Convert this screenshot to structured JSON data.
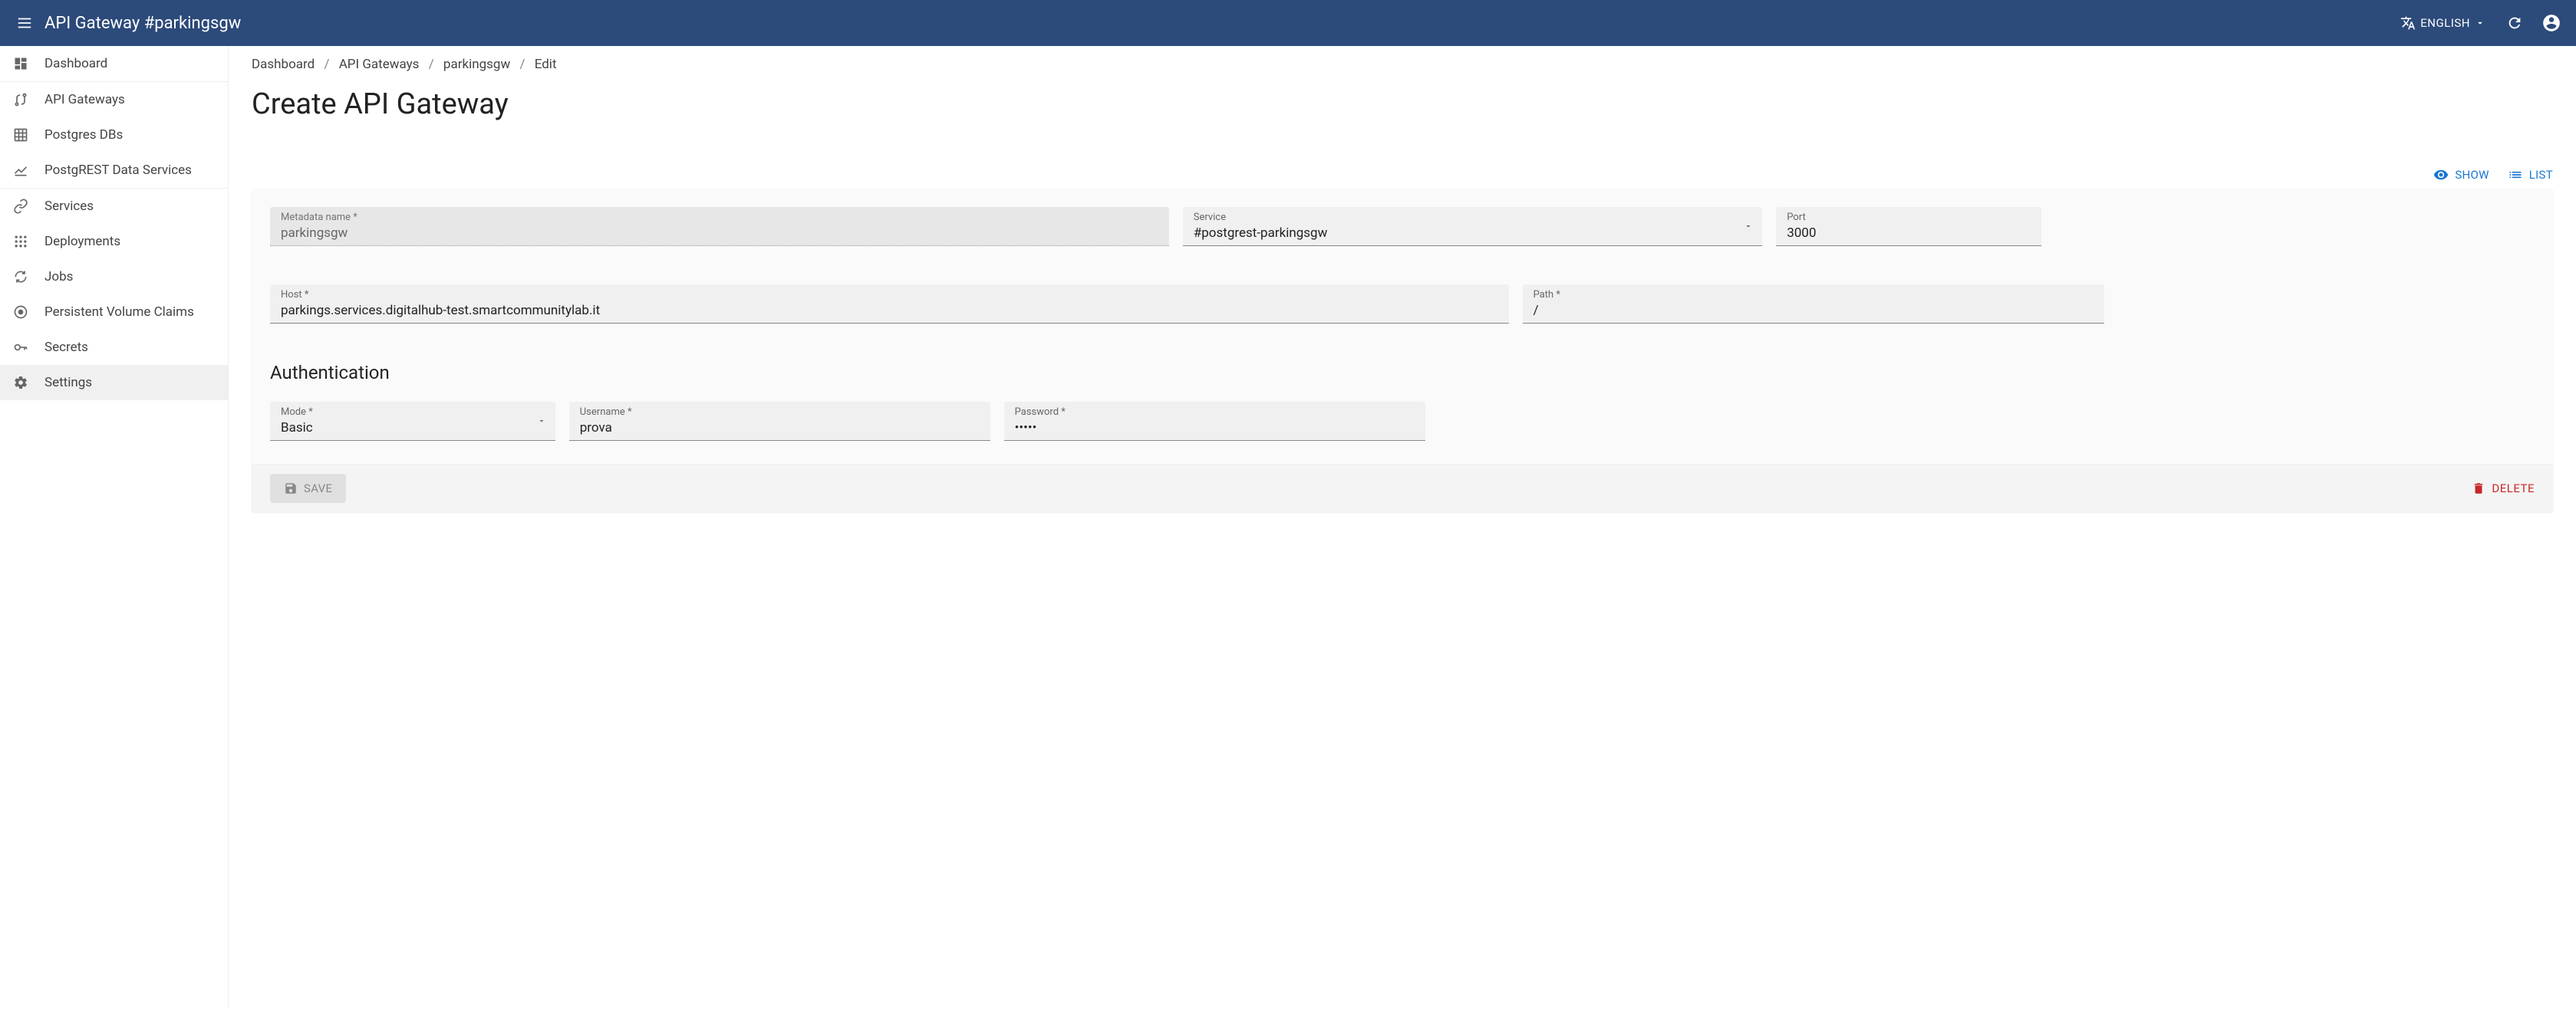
{
  "header": {
    "title": "API Gateway #parkingsgw",
    "language": "ENGLISH"
  },
  "sidebar": {
    "groups": [
      {
        "items": [
          {
            "label": "Dashboard"
          }
        ]
      },
      {
        "items": [
          {
            "label": "API Gateways"
          },
          {
            "label": "Postgres DBs"
          },
          {
            "label": "PostgREST Data Services"
          }
        ]
      },
      {
        "items": [
          {
            "label": "Services"
          },
          {
            "label": "Deployments"
          },
          {
            "label": "Jobs"
          },
          {
            "label": "Persistent Volume Claims"
          },
          {
            "label": "Secrets"
          },
          {
            "label": "Settings"
          }
        ]
      }
    ]
  },
  "breadcrumbs": [
    "Dashboard",
    "API Gateways",
    "parkingsgw",
    "Edit"
  ],
  "page_title": "Create API Gateway",
  "actions": {
    "show": "SHOW",
    "list": "LIST"
  },
  "form": {
    "metadata_name": {
      "label": "Metadata name *",
      "value": "parkingsgw"
    },
    "service": {
      "label": "Service",
      "value": "#postgrest-parkingsgw"
    },
    "port": {
      "label": "Port",
      "value": "3000"
    },
    "host": {
      "label": "Host *",
      "value": "parkings.services.digitalhub-test.smartcommunitylab.it"
    },
    "path": {
      "label": "Path *",
      "value": "/"
    },
    "auth_heading": "Authentication",
    "mode": {
      "label": "Mode *",
      "value": "Basic"
    },
    "username": {
      "label": "Username *",
      "value": "prova"
    },
    "password": {
      "label": "Password *",
      "value": "•••••"
    }
  },
  "buttons": {
    "save": "SAVE",
    "delete": "DELETE"
  }
}
